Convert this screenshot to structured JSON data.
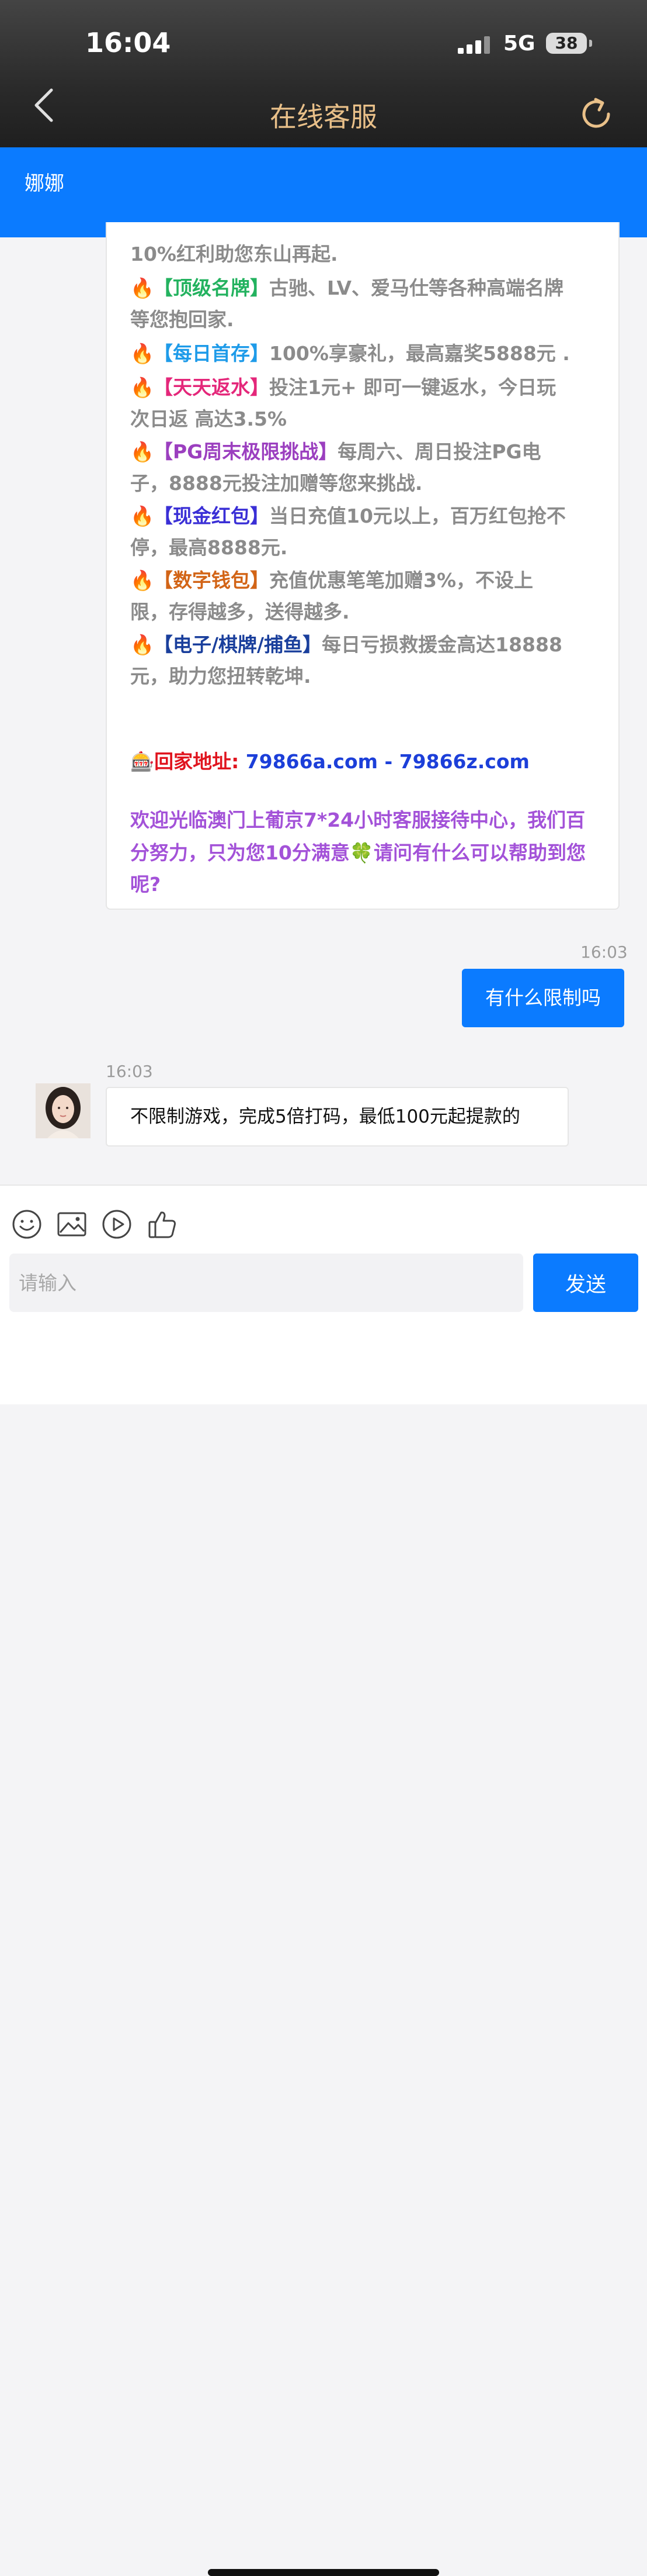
{
  "status_bar": {
    "time": "16:04",
    "network": "5G",
    "battery": "38"
  },
  "nav": {
    "title": "在线客服",
    "back_icon": "chevron-left-icon",
    "refresh_icon": "refresh-icon"
  },
  "agent": {
    "name": "娜娜"
  },
  "promo_message": {
    "line_0": "10%红利助您东山再起.",
    "items": [
      {
        "tag": "【顶级名牌】",
        "tag_color": "#23b25f",
        "text_1": "古驰、LV、爱马仕等各种高端名牌",
        "text_2": "等您抱回家."
      },
      {
        "tag": "【每日首存】",
        "tag_color": "#1e9be9",
        "text_1": "100%享豪礼，最高嘉奖5888元 .",
        "text_2": ""
      },
      {
        "tag": "【天天返水】",
        "tag_color": "#e4277a",
        "text_1": "投注1元+ 即可一键返水，今日玩",
        "text_2": "次日返 高达3.5%"
      },
      {
        "tag": "【PG周末极限挑战】",
        "tag_color": "#9b3fbf",
        "text_1": "每周六、周日投注PG电",
        "text_2": "子，8888元投注加赠等您来挑战."
      },
      {
        "tag": "【现金红包】",
        "tag_color": "#3a2fd6",
        "text_1": "当日充值10元以上，百万红包抢不",
        "text_2": "停，最高8888元."
      },
      {
        "tag": "【数字钱包】",
        "tag_color": "#d26416",
        "text_1": "充值优惠笔笔加赠3%，不设上",
        "text_2": "限，存得越多，送得越多."
      },
      {
        "tag": "【电子/棋牌/捕鱼】",
        "tag_color": "#1a3f9c",
        "text_1": "每日亏损救援金高达18888",
        "text_2": "元，助力您扭转乾坤."
      }
    ],
    "fire_emoji": "🔥",
    "slot_emoji": "🎰",
    "address_label": "回家地址:",
    "address_links": "79866a.com - 79866z.com",
    "welcome_1": "欢迎光临澳门上葡京7*24小时客服接待中心，我们百",
    "welcome_2": "分努力，只为您10分满意🍀请问有什么可以帮助到您",
    "welcome_3": "呢?"
  },
  "user_message": {
    "time": "16:03",
    "text": "有什么限制吗"
  },
  "agent_reply": {
    "time": "16:03",
    "text": "不限制游戏，完成5倍打码，最低100元起提款的"
  },
  "input": {
    "placeholder": "请输入",
    "value": "",
    "send_label": "发送",
    "tools": [
      "emoji-icon",
      "image-icon",
      "video-icon",
      "thumbs-up-icon"
    ]
  },
  "colors": {
    "accent": "#0b7bff",
    "title_gold": "#e9c089"
  }
}
